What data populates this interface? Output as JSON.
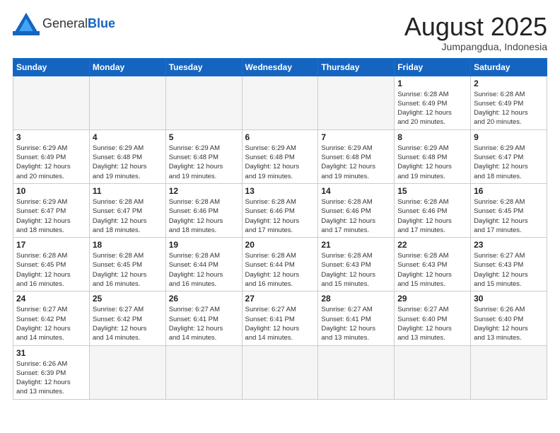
{
  "header": {
    "logo_general": "General",
    "logo_blue": "Blue",
    "month_title": "August 2025",
    "location": "Jumpangdua, Indonesia"
  },
  "weekdays": [
    "Sunday",
    "Monday",
    "Tuesday",
    "Wednesday",
    "Thursday",
    "Friday",
    "Saturday"
  ],
  "weeks": [
    [
      {
        "day": "",
        "info": "",
        "empty": true
      },
      {
        "day": "",
        "info": "",
        "empty": true
      },
      {
        "day": "",
        "info": "",
        "empty": true
      },
      {
        "day": "",
        "info": "",
        "empty": true
      },
      {
        "day": "",
        "info": "",
        "empty": true
      },
      {
        "day": "1",
        "info": "Sunrise: 6:28 AM\nSunset: 6:49 PM\nDaylight: 12 hours\nand 20 minutes."
      },
      {
        "day": "2",
        "info": "Sunrise: 6:28 AM\nSunset: 6:49 PM\nDaylight: 12 hours\nand 20 minutes."
      }
    ],
    [
      {
        "day": "3",
        "info": "Sunrise: 6:29 AM\nSunset: 6:49 PM\nDaylight: 12 hours\nand 20 minutes."
      },
      {
        "day": "4",
        "info": "Sunrise: 6:29 AM\nSunset: 6:48 PM\nDaylight: 12 hours\nand 19 minutes."
      },
      {
        "day": "5",
        "info": "Sunrise: 6:29 AM\nSunset: 6:48 PM\nDaylight: 12 hours\nand 19 minutes."
      },
      {
        "day": "6",
        "info": "Sunrise: 6:29 AM\nSunset: 6:48 PM\nDaylight: 12 hours\nand 19 minutes."
      },
      {
        "day": "7",
        "info": "Sunrise: 6:29 AM\nSunset: 6:48 PM\nDaylight: 12 hours\nand 19 minutes."
      },
      {
        "day": "8",
        "info": "Sunrise: 6:29 AM\nSunset: 6:48 PM\nDaylight: 12 hours\nand 19 minutes."
      },
      {
        "day": "9",
        "info": "Sunrise: 6:29 AM\nSunset: 6:47 PM\nDaylight: 12 hours\nand 18 minutes."
      }
    ],
    [
      {
        "day": "10",
        "info": "Sunrise: 6:29 AM\nSunset: 6:47 PM\nDaylight: 12 hours\nand 18 minutes."
      },
      {
        "day": "11",
        "info": "Sunrise: 6:28 AM\nSunset: 6:47 PM\nDaylight: 12 hours\nand 18 minutes."
      },
      {
        "day": "12",
        "info": "Sunrise: 6:28 AM\nSunset: 6:46 PM\nDaylight: 12 hours\nand 18 minutes."
      },
      {
        "day": "13",
        "info": "Sunrise: 6:28 AM\nSunset: 6:46 PM\nDaylight: 12 hours\nand 17 minutes."
      },
      {
        "day": "14",
        "info": "Sunrise: 6:28 AM\nSunset: 6:46 PM\nDaylight: 12 hours\nand 17 minutes."
      },
      {
        "day": "15",
        "info": "Sunrise: 6:28 AM\nSunset: 6:46 PM\nDaylight: 12 hours\nand 17 minutes."
      },
      {
        "day": "16",
        "info": "Sunrise: 6:28 AM\nSunset: 6:45 PM\nDaylight: 12 hours\nand 17 minutes."
      }
    ],
    [
      {
        "day": "17",
        "info": "Sunrise: 6:28 AM\nSunset: 6:45 PM\nDaylight: 12 hours\nand 16 minutes."
      },
      {
        "day": "18",
        "info": "Sunrise: 6:28 AM\nSunset: 6:45 PM\nDaylight: 12 hours\nand 16 minutes."
      },
      {
        "day": "19",
        "info": "Sunrise: 6:28 AM\nSunset: 6:44 PM\nDaylight: 12 hours\nand 16 minutes."
      },
      {
        "day": "20",
        "info": "Sunrise: 6:28 AM\nSunset: 6:44 PM\nDaylight: 12 hours\nand 16 minutes."
      },
      {
        "day": "21",
        "info": "Sunrise: 6:28 AM\nSunset: 6:43 PM\nDaylight: 12 hours\nand 15 minutes."
      },
      {
        "day": "22",
        "info": "Sunrise: 6:28 AM\nSunset: 6:43 PM\nDaylight: 12 hours\nand 15 minutes."
      },
      {
        "day": "23",
        "info": "Sunrise: 6:27 AM\nSunset: 6:43 PM\nDaylight: 12 hours\nand 15 minutes."
      }
    ],
    [
      {
        "day": "24",
        "info": "Sunrise: 6:27 AM\nSunset: 6:42 PM\nDaylight: 12 hours\nand 14 minutes."
      },
      {
        "day": "25",
        "info": "Sunrise: 6:27 AM\nSunset: 6:42 PM\nDaylight: 12 hours\nand 14 minutes."
      },
      {
        "day": "26",
        "info": "Sunrise: 6:27 AM\nSunset: 6:41 PM\nDaylight: 12 hours\nand 14 minutes."
      },
      {
        "day": "27",
        "info": "Sunrise: 6:27 AM\nSunset: 6:41 PM\nDaylight: 12 hours\nand 14 minutes."
      },
      {
        "day": "28",
        "info": "Sunrise: 6:27 AM\nSunset: 6:41 PM\nDaylight: 12 hours\nand 13 minutes."
      },
      {
        "day": "29",
        "info": "Sunrise: 6:27 AM\nSunset: 6:40 PM\nDaylight: 12 hours\nand 13 minutes."
      },
      {
        "day": "30",
        "info": "Sunrise: 6:26 AM\nSunset: 6:40 PM\nDaylight: 12 hours\nand 13 minutes."
      }
    ],
    [
      {
        "day": "31",
        "info": "Sunrise: 6:26 AM\nSunset: 6:39 PM\nDaylight: 12 hours\nand 13 minutes."
      },
      {
        "day": "",
        "info": "",
        "empty": true
      },
      {
        "day": "",
        "info": "",
        "empty": true
      },
      {
        "day": "",
        "info": "",
        "empty": true
      },
      {
        "day": "",
        "info": "",
        "empty": true
      },
      {
        "day": "",
        "info": "",
        "empty": true
      },
      {
        "day": "",
        "info": "",
        "empty": true
      }
    ]
  ]
}
